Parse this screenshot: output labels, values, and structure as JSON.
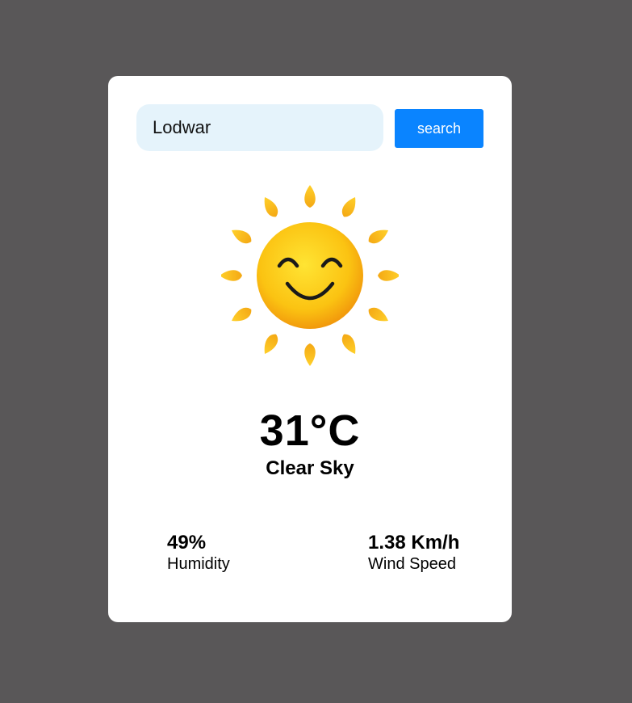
{
  "search": {
    "value": "Lodwar",
    "button_label": "search"
  },
  "weather": {
    "icon": "smiling-sun-icon",
    "temperature": "31°C",
    "condition": "Clear Sky"
  },
  "stats": {
    "humidity": {
      "value": "49%",
      "label": "Humidity"
    },
    "wind": {
      "value": "1.38 Km/h",
      "label": "Wind Speed"
    }
  },
  "colors": {
    "background": "#595758",
    "card": "#ffffff",
    "input_bg": "#e5f3fb",
    "button": "#0a84ff",
    "sun": "#f5c518"
  }
}
